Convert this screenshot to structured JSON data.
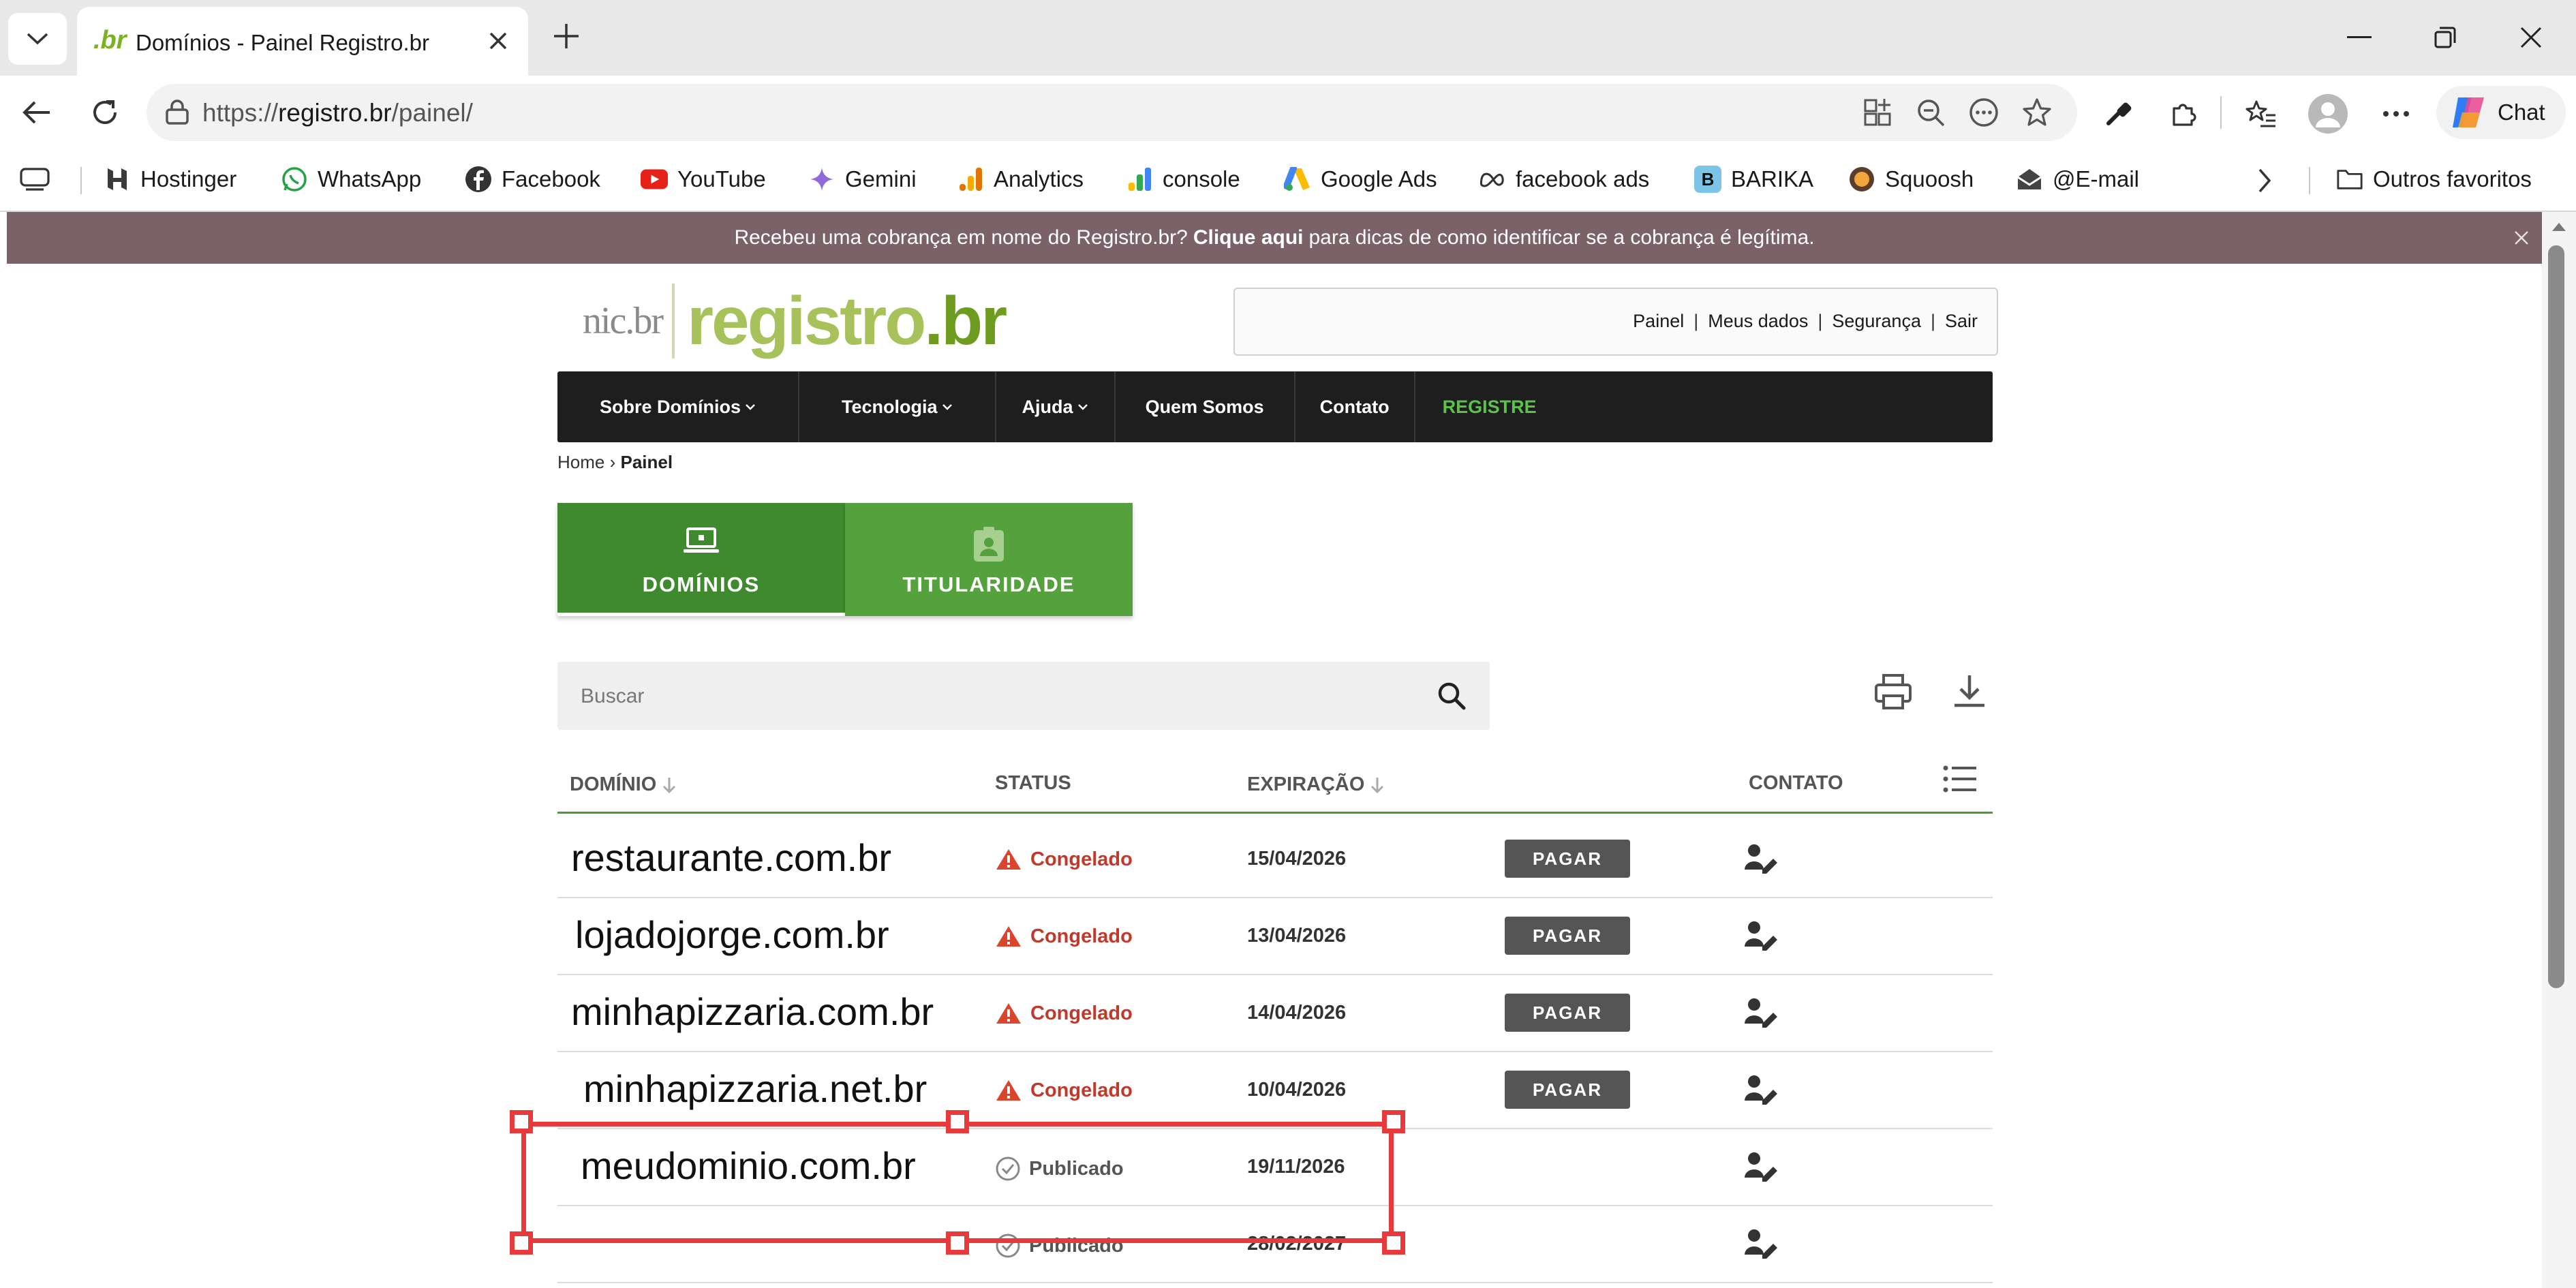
{
  "browser": {
    "tab_title": "Domínios - Painel Registro.br",
    "tab_favicon": ".br",
    "url_scheme": "https://",
    "url_host": "registro.br",
    "url_path": "/painel/",
    "chat_label": "Chat",
    "bookmarks": [
      {
        "label": "Hostinger",
        "icon": "hostinger-icon"
      },
      {
        "label": "WhatsApp",
        "icon": "whatsapp-icon"
      },
      {
        "label": "Facebook",
        "icon": "facebook-icon"
      },
      {
        "label": "YouTube",
        "icon": "youtube-icon"
      },
      {
        "label": "Gemini",
        "icon": "gemini-icon"
      },
      {
        "label": "Analytics",
        "icon": "analytics-icon"
      },
      {
        "label": "console",
        "icon": "console-icon"
      },
      {
        "label": "Google Ads",
        "icon": "google-ads-icon"
      },
      {
        "label": "facebook ads",
        "icon": "meta-icon"
      },
      {
        "label": "BARIKA",
        "icon": "barika-icon"
      },
      {
        "label": "Squoosh",
        "icon": "squoosh-icon"
      },
      {
        "label": "@E-mail",
        "icon": "email-icon"
      }
    ],
    "other_favorites": "Outros favoritos"
  },
  "alert": {
    "text_before": "Recebeu uma cobrança em nome do Registro.br?",
    "link": "Clique aqui",
    "text_after": "para dicas de como identificar se a cobrança é legítima."
  },
  "site": {
    "logo_nic": "nic.br",
    "logo_registro": "registro",
    "logo_br": ".br",
    "user_links": [
      "Painel",
      "Meus dados",
      "Segurança",
      "Sair"
    ],
    "nav": [
      "Sobre Domínios",
      "Tecnologia",
      "Ajuda",
      "Quem Somos",
      "Contato",
      "REGISTRE"
    ],
    "breadcrumb_home": "Home",
    "breadcrumb_sep": "›",
    "breadcrumb_current": "Painel"
  },
  "tabs": {
    "dominios": "DOMÍNIOS",
    "titularidade": "TITULARIDADE"
  },
  "search": {
    "placeholder": "Buscar"
  },
  "table": {
    "headers": {
      "dominio": "DOMÍNIO",
      "status": "STATUS",
      "expiracao": "EXPIRAÇÃO",
      "contato": "CONTATO"
    },
    "pay_label": "PAGAR",
    "rows": [
      {
        "domain": "restaurante.com.br",
        "status": "Congelado",
        "expires": "15/04/2026"
      },
      {
        "domain": "lojadojorge.com.br",
        "status": "Congelado",
        "expires": "13/04/2026"
      },
      {
        "domain": "minhapizzaria.com.br",
        "status": "Congelado",
        "expires": "14/04/2026"
      },
      {
        "domain": "minhapizzaria.net.br",
        "status": "Congelado",
        "expires": "10/04/2026"
      },
      {
        "domain": "meudominio.com.br",
        "status": "Publicado",
        "expires": "19/11/2026"
      },
      {
        "domain": "",
        "status": "Publicado",
        "expires": "28/02/2027"
      }
    ]
  },
  "colors": {
    "brand_green": "#3f8a2e",
    "alert_bg": "#7b6268",
    "congelado": "#c0392b",
    "annotation": "#e83a3a"
  }
}
